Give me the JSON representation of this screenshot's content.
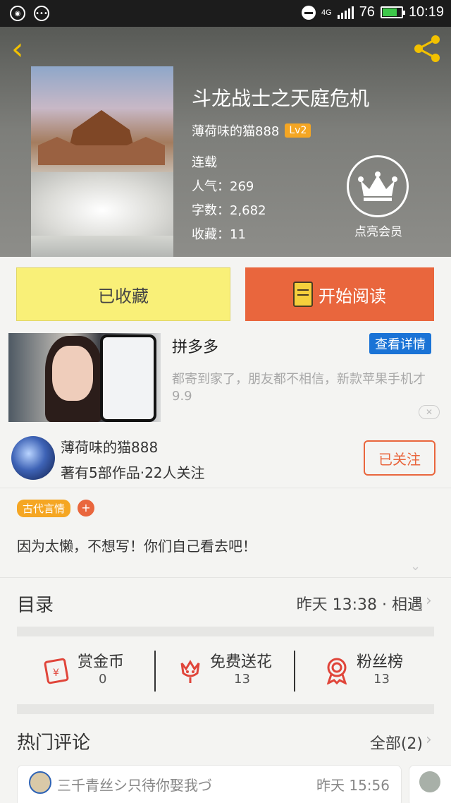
{
  "status_bar": {
    "network": "4G",
    "battery": "76",
    "time": "10:19"
  },
  "book": {
    "title": "斗龙战士之天庭危机",
    "author": "薄荷味的猫888",
    "author_level": "Lv2",
    "status": "连载",
    "popularity": "人气：269",
    "word_count": "字数：2,682",
    "favorites": "收藏：11",
    "vip_label": "点亮会员"
  },
  "actions": {
    "collected": "已收藏",
    "start_reading": "开始阅读"
  },
  "ad": {
    "title": "拼多多",
    "detail_button": "查看详情",
    "description": "都寄到家了，朋友都不相信，新款苹果手机才9.9",
    "close": "✕"
  },
  "author_card": {
    "name": "薄荷味的猫888",
    "summary": "著有5部作品·22人关注",
    "follow_button": "已关注"
  },
  "tags": {
    "items": [
      "古代言情"
    ],
    "add": "+"
  },
  "description": "因为太懒，不想写！你们自己看去吧！",
  "toc": {
    "label": "目录",
    "latest": "昨天 13:38 · 相遇"
  },
  "stats": {
    "reward": {
      "label": "赏金币",
      "count": "0"
    },
    "flowers": {
      "label": "免费送花",
      "count": "13"
    },
    "fans": {
      "label": "粉丝榜",
      "count": "13"
    }
  },
  "comments": {
    "label": "热门评论",
    "all": "全部(2)",
    "items": [
      {
        "user": "三千青丝シ只待你娶我づ",
        "time": "昨天 15:56"
      }
    ]
  },
  "colors": {
    "accent": "#e9663d",
    "collect_bg": "#f9f078",
    "link_blue": "#1a73d6",
    "tag": "#f5a623"
  }
}
